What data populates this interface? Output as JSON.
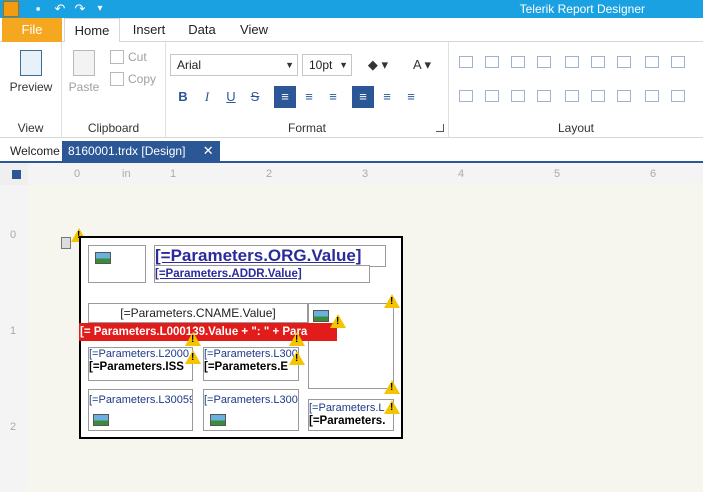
{
  "app": {
    "title": "Telerik Report Designer"
  },
  "tabs": [
    "File",
    "Home",
    "Insert",
    "Data",
    "View"
  ],
  "ribbon": {
    "view_group": {
      "label": "View",
      "preview": "Preview"
    },
    "clipboard_group": {
      "label": "Clipboard",
      "paste": "Paste",
      "cut": "Cut",
      "copy": "Copy"
    },
    "format_group": {
      "label": "Format",
      "font_family": "Arial",
      "font_size": "10pt",
      "bold": "B",
      "italic": "I",
      "underline": "U",
      "strike": "S"
    },
    "layout_group": {
      "label": "Layout"
    }
  },
  "doc_tabs": {
    "welcome": "Welcome",
    "active": "8160001.trdx [Design]",
    "close": "✕"
  },
  "ruler": {
    "h": [
      "0",
      "in",
      "1",
      "2",
      "3",
      "4",
      "5",
      "6"
    ],
    "v": [
      "0",
      "1",
      "2"
    ]
  },
  "report": {
    "org": "[=Parameters.ORG.Value]",
    "addr": "[=Parameters.ADDR.Value]",
    "cname": "[=Parameters.CNAME.Value]",
    "red_expr": "[= Parameters.L000139.Value + \":  \" + Para",
    "l2000": "[=Parameters.L2000",
    "l300_a": "[=Parameters.L300",
    "iss": "[=Parameters.ISS",
    "bold_e": "[=Parameters.E",
    "l30059": "[=Parameters.L30059",
    "l300_b": "[=Parameters.L300",
    "l_right": "[=Parameters.L",
    "right_bold": "[=Parameters."
  },
  "colors": {
    "titlebar": "#1aa1e2",
    "file_tab": "#f4a71f",
    "accent": "#2b5797",
    "error_red": "#e21b1b"
  }
}
